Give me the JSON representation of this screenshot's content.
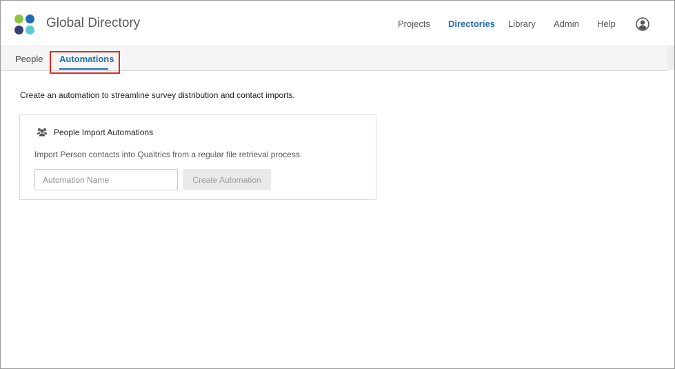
{
  "app": {
    "title": "Global Directory",
    "logo_colors": [
      "#8cc63f",
      "#1f6cb5",
      "#3a3f73",
      "#5bc8d3"
    ]
  },
  "nav": {
    "items": [
      {
        "label": "Projects",
        "active": false
      },
      {
        "label": "Directories",
        "active": true
      },
      {
        "label": "Library",
        "active": false
      },
      {
        "label": "Admin",
        "active": false
      },
      {
        "label": "Help",
        "active": false
      }
    ],
    "user_icon": "user-circle-icon"
  },
  "tabs": [
    {
      "label": "People",
      "active": false
    },
    {
      "label": "Automations",
      "active": true
    }
  ],
  "content": {
    "intro": "Create an automation to streamline survey distribution and contact imports.",
    "card": {
      "icon": "people-group-icon",
      "title": "People Import Automations",
      "description": "Import Person contacts into Qualtrics from a regular file retrieval process.",
      "input_placeholder": "Automation Name",
      "input_value": "",
      "button_label": "Create Automation",
      "button_disabled": true
    }
  },
  "colors": {
    "accent": "#1f6cb5",
    "highlight": "#e0281f"
  }
}
